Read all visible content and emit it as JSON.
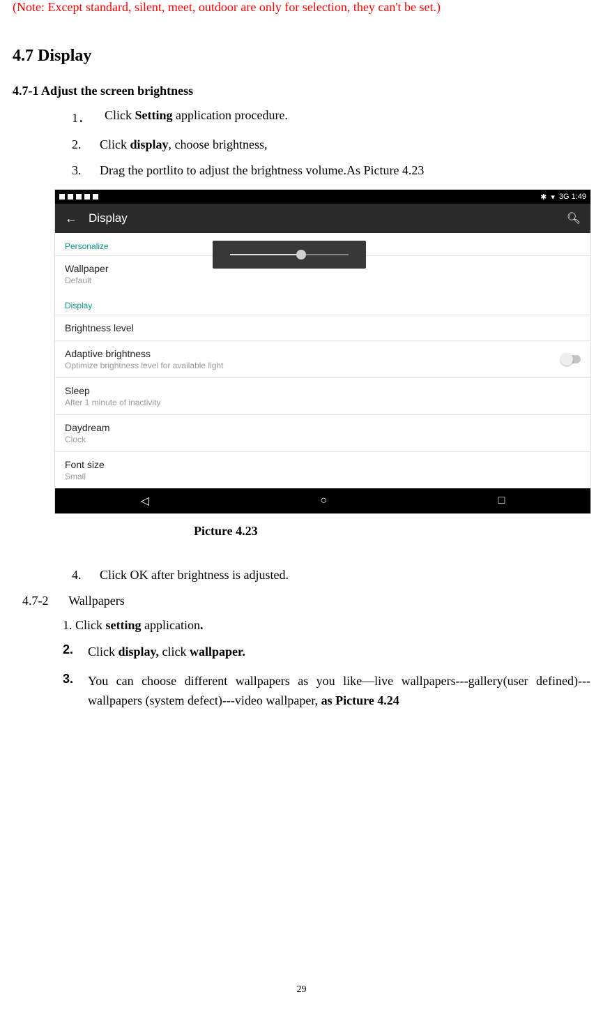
{
  "note": "(Note: Except standard, silent, meet, outdoor are only for selection, they can't be set.)",
  "section_title": "4.7 Display",
  "sub1": {
    "title": "4.7-1 Adjust the screen brightness",
    "items": [
      {
        "num": "1．",
        "pre": "Click ",
        "bold": "Setting",
        "post": " application procedure."
      },
      {
        "num": "2.",
        "pre": "Click ",
        "bold": "display",
        "post": ", choose brightness,"
      },
      {
        "num": "3.",
        "pre": "Drag the portlito to adjust the brightness volume.As Picture 4.23",
        "bold": "",
        "post": ""
      }
    ]
  },
  "screenshot": {
    "status_right": "3G   1:49",
    "app_title": "Display",
    "groups": {
      "personalize": "Personalize",
      "display": "Display"
    },
    "wallpaper": {
      "title": "Wallpaper",
      "sub": "Default"
    },
    "brightness": {
      "title": "Brightness level"
    },
    "adaptive": {
      "title": "Adaptive brightness",
      "sub": "Optimize brightness level for available light"
    },
    "sleep": {
      "title": "Sleep",
      "sub": "After 1 minute of inactivity"
    },
    "daydream": {
      "title": "Daydream",
      "sub": "Clock"
    },
    "font": {
      "title": "Font size",
      "sub": "Small"
    }
  },
  "picture_label": "Picture 4.23",
  "step4": {
    "num": "4.",
    "text": "Click OK after brightness is adjusted."
  },
  "sub2": {
    "num": "4.7-2",
    "title": "Wallpapers",
    "step1": {
      "pre": "1. Click ",
      "bold1": "setting",
      "mid": " application",
      "bold2": "."
    },
    "items": [
      {
        "num": "2.",
        "parts": [
          "Click ",
          "display,",
          " click ",
          "wallpaper."
        ]
      },
      {
        "num": "3.",
        "pre": "You can choose different wallpapers as you like—live wallpapers---gallery(user defined)---wallpapers (system defect)---video wallpaper, ",
        "bold": "as Picture 4.24"
      }
    ]
  },
  "page_number": "29"
}
